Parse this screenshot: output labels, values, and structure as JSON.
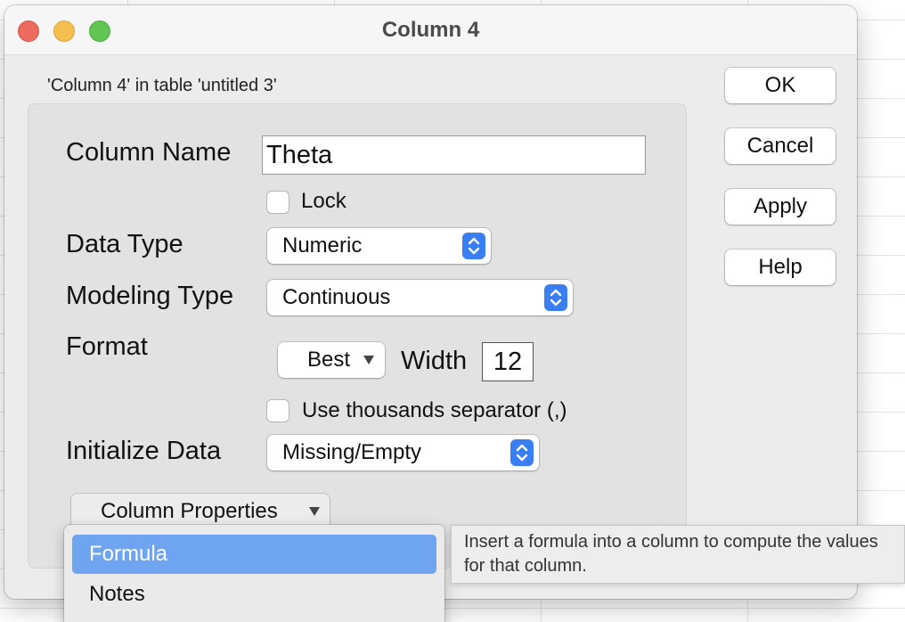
{
  "window": {
    "title": "Column 4",
    "subtitle": "'Column 4' in table 'untitled 3'"
  },
  "form": {
    "column_name_label": "Column Name",
    "column_name_value": "Theta",
    "lock_label": "Lock",
    "data_type_label": "Data Type",
    "data_type_value": "Numeric",
    "modeling_type_label": "Modeling Type",
    "modeling_type_value": "Continuous",
    "format_label": "Format",
    "format_value": "Best",
    "width_label": "Width",
    "width_value": "12",
    "thousands_label": "Use thousands separator (,)",
    "initialize_label": "Initialize Data",
    "initialize_value": "Missing/Empty",
    "column_properties_label": "Column Properties"
  },
  "buttons": {
    "ok": "OK",
    "cancel": "Cancel",
    "apply": "Apply",
    "help": "Help"
  },
  "menu": {
    "items": [
      {
        "label": "Formula",
        "selected": true
      },
      {
        "label": "Notes",
        "selected": false
      }
    ]
  },
  "tooltip": {
    "text": "Insert a formula into a column to compute the values for that column."
  },
  "colors": {
    "accent": "#3a7ef3",
    "menu_highlight": "#6fa5f0",
    "close": "#ed6a5e",
    "minimize": "#f5bf4f",
    "maximize": "#61c554"
  },
  "icons": {
    "stepper": "up-down-chevron-icon",
    "dropdown": "triangle-down-icon"
  }
}
